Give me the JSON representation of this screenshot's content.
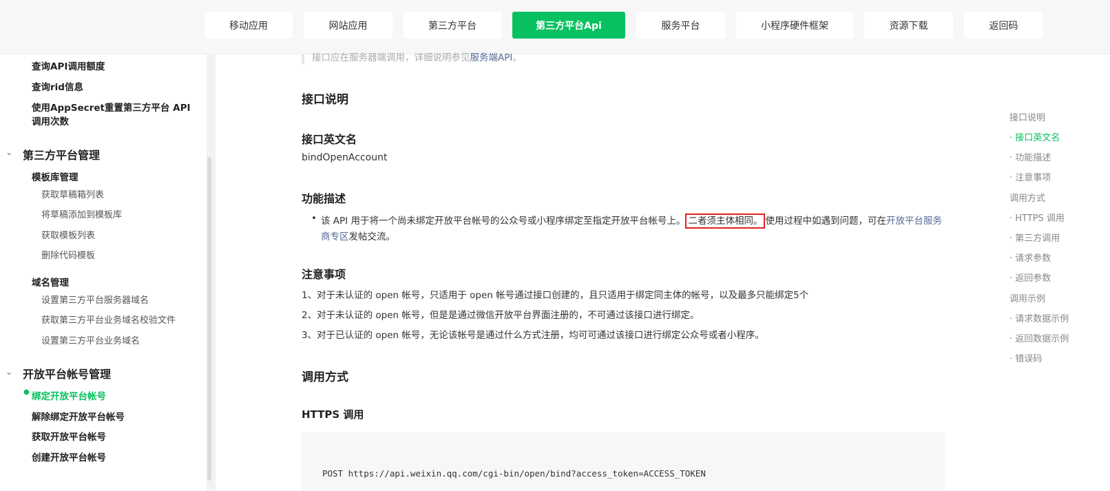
{
  "nav": {
    "tabs": [
      {
        "label": "移动应用"
      },
      {
        "label": "网站应用"
      },
      {
        "label": "第三方平台"
      },
      {
        "label": "第三方平台Api",
        "active": true
      },
      {
        "label": "服务平台"
      },
      {
        "label": "小程序硬件框架"
      },
      {
        "label": "资源下载"
      },
      {
        "label": "返回码"
      }
    ]
  },
  "sidebar": {
    "top_items": [
      "查询API调用额度",
      "查询rid信息",
      "使用AppSecret重置第三方平台 API",
      "调用次数"
    ],
    "section1": {
      "title": "第三方平台管理",
      "group1": {
        "title": "模板库管理",
        "items": [
          "获取草稿箱列表",
          "将草稿添加到模板库",
          "获取模板列表",
          "删除代码模板"
        ]
      },
      "group2": {
        "title": "域名管理",
        "items": [
          "设置第三方平台服务器域名",
          "获取第三方平台业务域名校验文件",
          "设置第三方平台业务域名"
        ]
      }
    },
    "section2": {
      "title": "开放平台帐号管理",
      "items": [
        "绑定开放平台帐号",
        "解除绑定开放平台帐号",
        "获取开放平台帐号",
        "创建开放平台帐号"
      ]
    }
  },
  "content": {
    "truncated_line": {
      "prefix": "接口应在服务器端调用，详细说明参见",
      "link": "服务端API",
      "suffix": "。"
    },
    "h_interface": "接口说明",
    "h_english_name": "接口英文名",
    "english_name": "bindOpenAccount",
    "h_function": "功能描述",
    "function_desc": {
      "part1": "该 API 用于将一个尚未绑定开放平台帐号的公众号或小程序绑定至指定开放平台帐号上。",
      "highlight": "二者须主体相同。",
      "part2": "使用过程中如遇到问题，可在",
      "link1": "开放平台服务",
      "link2": "商专区",
      "part3": "发帖交流。"
    },
    "h_notes": "注意事项",
    "notes": [
      "1、对于未认证的 open 帐号，只适用于 open 帐号通过接口创建的，且只适用于绑定同主体的帐号，以及最多只能绑定5个",
      "2、对于未认证的 open 帐号，但是是通过微信开放平台界面注册的，不可通过该接口进行绑定。",
      "3、对于已认证的 open 帐号，无论该帐号是通过什么方式注册，均可可通过该接口进行绑定公众号或者小程序。"
    ],
    "h_call": "调用方式",
    "h_https": "HTTPS 调用",
    "code": "POST https://api.weixin.qq.com/cgi-bin/open/bind?access_token=ACCESS_TOKEN"
  },
  "toc": {
    "items": [
      {
        "label": "接口说明",
        "level": 1
      },
      {
        "label": "接口英文名",
        "level": 2,
        "active": true
      },
      {
        "label": "功能描述",
        "level": 2
      },
      {
        "label": "注意事项",
        "level": 2
      },
      {
        "label": "调用方式",
        "level": 1
      },
      {
        "label": "HTTPS 调用",
        "level": 2
      },
      {
        "label": "第三方调用",
        "level": 2
      },
      {
        "label": "请求参数",
        "level": 2
      },
      {
        "label": "返回参数",
        "level": 2
      },
      {
        "label": "调用示例",
        "level": 1
      },
      {
        "label": "请求数据示例",
        "level": 2
      },
      {
        "label": "返回数据示例",
        "level": 2
      },
      {
        "label": "错误码",
        "level": 2
      }
    ]
  },
  "colors": {
    "accent": "#07c160",
    "link": "#576b95",
    "highlight_border": "#e02020"
  }
}
